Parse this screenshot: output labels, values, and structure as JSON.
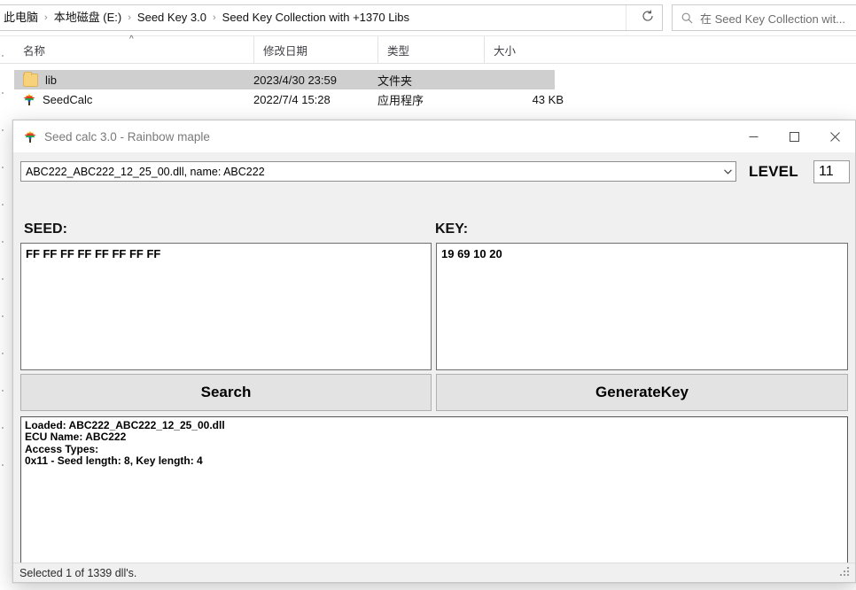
{
  "explorer": {
    "breadcrumb": {
      "items": [
        "此电脑",
        "本地磁盘 (E:)",
        "Seed Key 3.0",
        "Seed Key Collection with +1370 Libs"
      ],
      "separator": "›"
    },
    "chevron_icon": "chevron-down-icon",
    "refresh_icon": "refresh-icon",
    "search": {
      "icon": "search-icon",
      "text": "在 Seed Key Collection wit..."
    },
    "columns": [
      {
        "label": "名称"
      },
      {
        "label": "修改日期"
      },
      {
        "label": "类型"
      },
      {
        "label": "大小"
      }
    ],
    "sort_caret": "^",
    "rows": [
      {
        "icon": "folder-icon",
        "name": "lib",
        "date": "2023/4/30 23:59",
        "type": "文件夹",
        "size": "",
        "selected": true
      },
      {
        "icon": "maple-leaf-icon",
        "name": "SeedCalc",
        "date": "2022/7/4 15:28",
        "type": "应用程序",
        "size": "43 KB",
        "selected": false
      }
    ]
  },
  "dialog": {
    "icon": "maple-leaf-icon",
    "title": "Seed calc 3.0 - Rainbow maple",
    "controls": {
      "minimize": "minimize-icon",
      "maximize": "maximize-icon",
      "close": "close-icon"
    },
    "combo": {
      "value": "ABC222_ABC222_12_25_00.dll, name: ABC222",
      "arrow_icon": "chevron-down-icon"
    },
    "level": {
      "label": "LEVEL",
      "value": "11"
    },
    "seed": {
      "label": "SEED:",
      "value": "FF FF FF FF FF FF FF FF"
    },
    "key": {
      "label": "KEY:",
      "value": "19 69 10 20"
    },
    "buttons": {
      "search": "Search",
      "generate_key": "GenerateKey"
    },
    "log": "Loaded: ABC222_ABC222_12_25_00.dll\nECU Name: ABC222\nAccess Types:\n0x11 - Seed length: 8, Key length: 4",
    "status": "Selected 1 of 1339 dll's.",
    "grip_icon": "resize-grip-icon"
  }
}
